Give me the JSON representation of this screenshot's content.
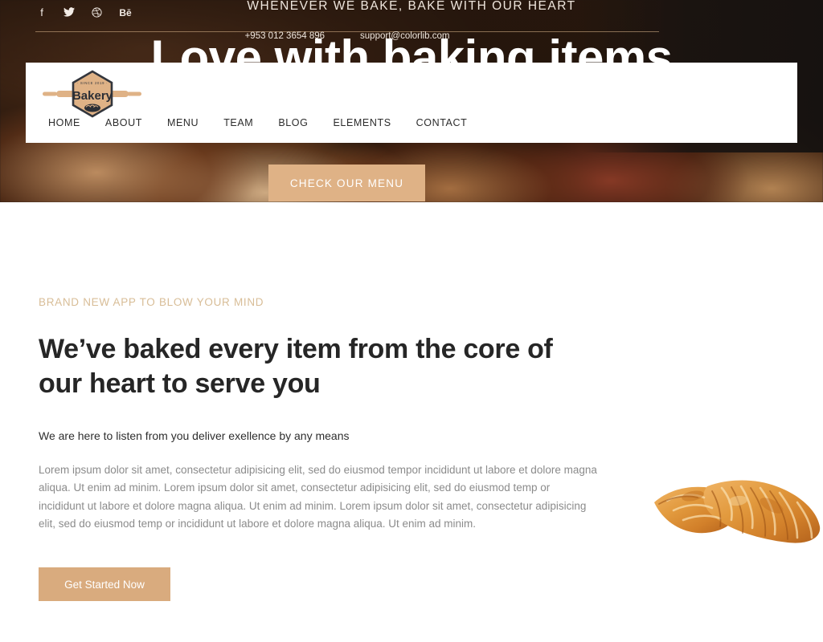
{
  "hero": {
    "tagline": "WHENEVER WE BAKE, BAKE WITH OUR HEART",
    "title": "Love with baking items",
    "cta_label": "CHECK OUR MENU",
    "overlay_color": "#3a2215",
    "accent_color": "#dfb286"
  },
  "topbar": {
    "social": [
      {
        "name": "facebook-icon",
        "glyph": "f"
      },
      {
        "name": "twitter-icon",
        "glyph": ""
      },
      {
        "name": "dribbble-icon",
        "glyph": ""
      },
      {
        "name": "behance-icon",
        "glyph": "Bē"
      }
    ],
    "phone": "+953 012 3654 896",
    "email": "support@colorlib.com"
  },
  "logo": {
    "since": "SINCE 2019",
    "name": "Bakery"
  },
  "nav": {
    "items": [
      {
        "label": "HOME"
      },
      {
        "label": "ABOUT"
      },
      {
        "label": "MENU"
      },
      {
        "label": "TEAM"
      },
      {
        "label": "BLOG"
      },
      {
        "label": "ELEMENTS"
      },
      {
        "label": "CONTACT"
      }
    ]
  },
  "main": {
    "eyebrow": "BRAND NEW APP TO BLOW YOUR MIND",
    "eyebrow_color": "#d8bd97",
    "heading": "We’ve baked every item from the core of our heart to serve you",
    "lead": "We are here to listen from you deliver exellence by any means",
    "paragraph": "Lorem ipsum dolor sit amet, consectetur adipisicing elit, sed do eiusmod tempor incididunt ut labore et dolore magna aliqua. Ut enim ad minim. Lorem ipsum dolor sit amet, consectetur adipisicing elit, sed do eiusmod temp or incididunt ut labore et dolore magna aliqua. Ut enim ad minim. Lorem ipsum dolor sit amet, consectetur adipisicing elit, sed do eiusmod temp or incididunt ut labore et dolore magna aliqua. Ut enim ad minim.",
    "cta_label": "Get Started Now",
    "cta_color": "#d9ab7e"
  }
}
